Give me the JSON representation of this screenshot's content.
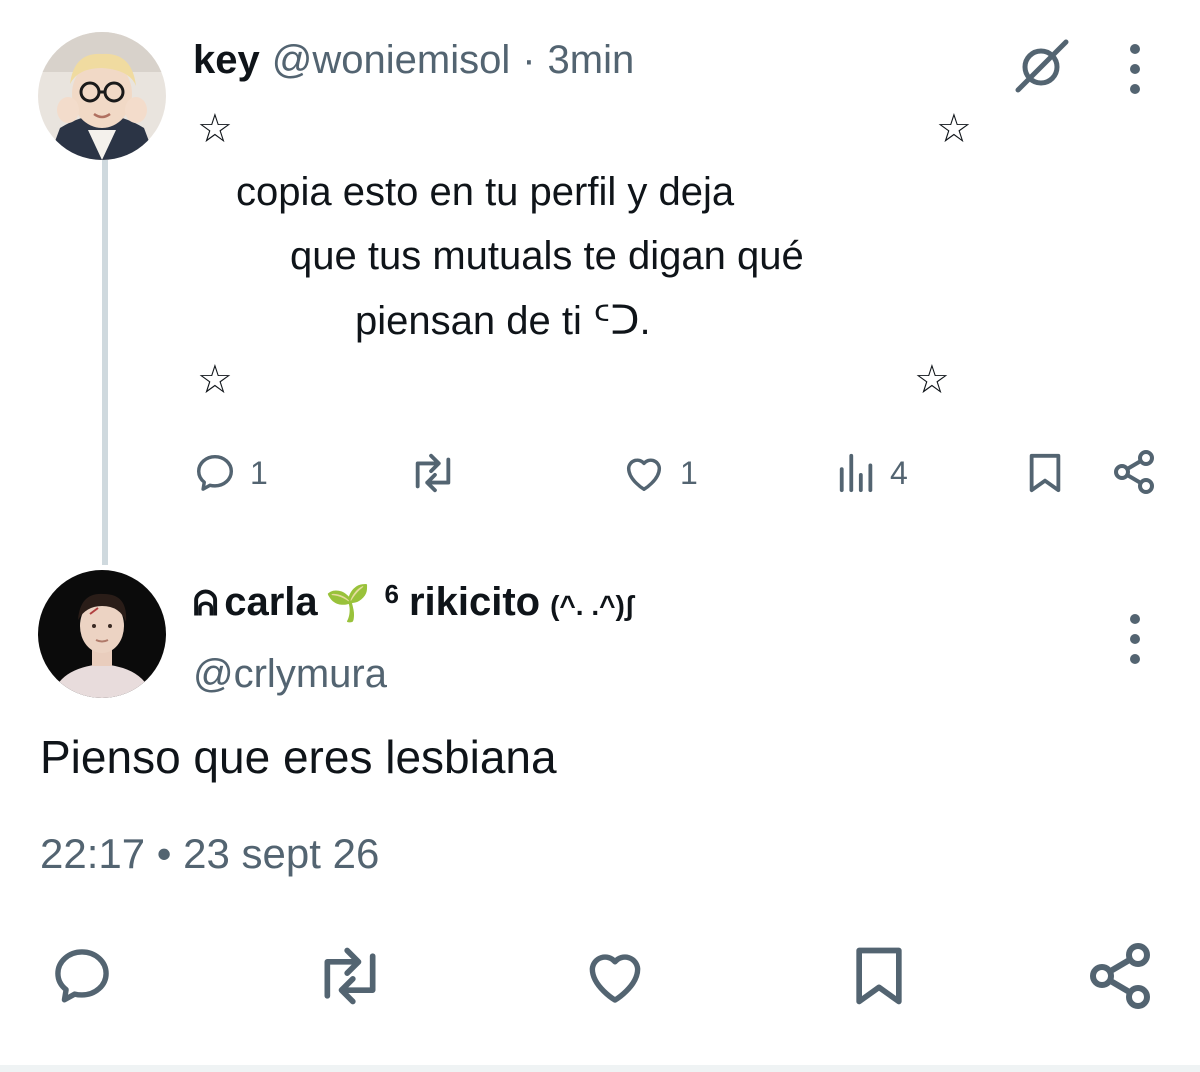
{
  "original_tweet": {
    "display_name": "key",
    "handle": "@woniemisol",
    "separator": "·",
    "time": "3min",
    "text_lines": [
      "copia esto en tu perfil y deja",
      "que tus mutuals te digan qué",
      "piensan de ti ᑦᑐ."
    ],
    "decor_star": "☆",
    "actions": {
      "replies": "1",
      "retweets": "",
      "likes": "1",
      "views": "4"
    }
  },
  "reply_tweet": {
    "display_name_prefix": "ᕱ",
    "display_name": "carla",
    "emoji": "🌱",
    "display_name_suffix_sup": "6",
    "display_name_suffix": "rikicito",
    "kaomoji": "(^. .^)ʃ",
    "handle": "@crlymura",
    "text": "Pienso que eres lesbiana",
    "timestamp": "22:17 • 23 sept 26"
  },
  "colors": {
    "text": "#0f1419",
    "muted": "#536471",
    "thread_line": "#cfd9de",
    "background": "#ffffff"
  },
  "icons": [
    "grok-icon",
    "more-icon",
    "reply-icon",
    "retweet-icon",
    "like-icon",
    "views-icon",
    "bookmark-icon",
    "share-icon"
  ]
}
